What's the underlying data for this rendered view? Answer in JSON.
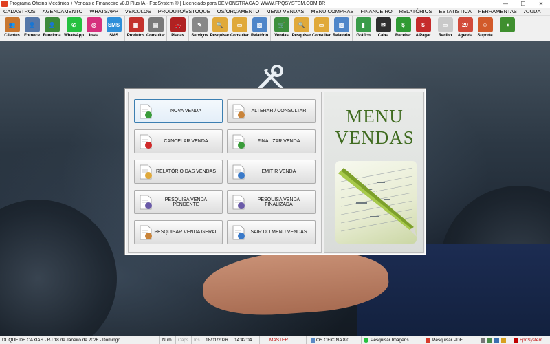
{
  "window": {
    "title": "Programa Oficina Mecânica + Vendas e Financeiro v8.0 Plus IA - FpqSystem ® | Licenciado para  DEMONSTRACAO WWW.FPQSYSTEM.COM.BR",
    "minimize": "—",
    "maximize": "☐",
    "close": "✕"
  },
  "menubar": [
    "CADASTROS",
    "AGENDAMENTO",
    "WHATSAPP",
    "VEICULOS",
    "PRODUTO/ESTOQUE",
    "OS/ORÇAMENTO",
    "MENU VENDAS",
    "MENU COMPRAS",
    "FINANCEIRO",
    "RELATÓRIOS",
    "ESTATISTICA",
    "FERRAMENTAS",
    "AJUDA"
  ],
  "toolbar": {
    "groups": [
      [
        {
          "label": "Clientes",
          "icon": "clients-icon",
          "color": "#c8762f",
          "glyph": "👥"
        },
        {
          "label": "Fornece",
          "icon": "supplier-icon",
          "color": "#5577a8",
          "glyph": "👤"
        },
        {
          "label": "Funciona",
          "icon": "employee-icon",
          "color": "#3e8a3a",
          "glyph": "👤"
        }
      ],
      [
        {
          "label": "WhatsApp",
          "icon": "whatsapp-icon",
          "color": "#25c13f",
          "glyph": "✆"
        },
        {
          "label": "Insta",
          "icon": "instagram-icon",
          "color": "#d6307d",
          "glyph": "◎"
        },
        {
          "label": "SMS",
          "icon": "sms-icon",
          "color": "#2e8fd9",
          "glyph": "SMS"
        }
      ],
      [
        {
          "label": "Produtos",
          "icon": "products-icon",
          "color": "#c4322d",
          "glyph": "▦"
        },
        {
          "label": "Consultar",
          "icon": "consult-icon",
          "color": "#7a7a7a",
          "glyph": "▤"
        }
      ],
      [
        {
          "label": "Placas",
          "icon": "car-icon",
          "color": "#b02222",
          "glyph": "🚗"
        }
      ],
      [
        {
          "label": "Serviços",
          "icon": "services-icon",
          "color": "#888888",
          "glyph": "✎"
        },
        {
          "label": "Pesquisar",
          "icon": "search-folder-icon",
          "color": "#e0a93a",
          "glyph": "🔍"
        },
        {
          "label": "Consultar",
          "icon": "consult-folder-icon",
          "color": "#e0a93a",
          "glyph": "▭"
        },
        {
          "label": "Relatório",
          "icon": "report-icon",
          "color": "#4f86c9",
          "glyph": "▨"
        }
      ],
      [
        {
          "label": "Vendas",
          "icon": "cart-icon",
          "color": "#3d8f3d",
          "glyph": "🛒"
        },
        {
          "label": "Pesquisar",
          "icon": "search-folder-icon",
          "color": "#e0a93a",
          "glyph": "🔍"
        },
        {
          "label": "Consultar",
          "icon": "consult-folder-icon",
          "color": "#e0a93a",
          "glyph": "▭"
        },
        {
          "label": "Relatório",
          "icon": "report-icon",
          "color": "#4f86c9",
          "glyph": "▨"
        }
      ],
      [
        {
          "label": "Gráfico",
          "icon": "chart-icon",
          "color": "#3a9c4a",
          "glyph": "▮"
        },
        {
          "label": "Caixa",
          "icon": "cash-icon",
          "color": "#2f2f2f",
          "glyph": "✉"
        },
        {
          "label": "Receber",
          "icon": "receive-icon",
          "color": "#2f9a33",
          "glyph": "$"
        },
        {
          "label": "A Pagar",
          "icon": "pay-icon",
          "color": "#c52b2b",
          "glyph": "$"
        }
      ],
      [
        {
          "label": "Recibo",
          "icon": "receipt-icon",
          "color": "#c9c9c9",
          "glyph": "▭"
        },
        {
          "label": "Agenda",
          "icon": "calendar-icon",
          "color": "#d24a3a",
          "glyph": "29"
        },
        {
          "label": "Suporte",
          "icon": "support-icon",
          "color": "#d25a2a",
          "glyph": "☺"
        }
      ],
      [
        {
          "label": "",
          "icon": "exit-icon",
          "color": "#3f8f2f",
          "glyph": "⇥"
        }
      ]
    ]
  },
  "panel": {
    "title_line1": "MENU",
    "title_line2": "VENDAS",
    "buttons": [
      {
        "label": "NOVA VENDA",
        "icon": "new-sale-icon"
      },
      {
        "label": "ALTERAR / CONSULTAR",
        "icon": "edit-icon"
      },
      {
        "label": "CANCELAR VENDA",
        "icon": "cancel-sale-icon"
      },
      {
        "label": "FINALIZAR VENDA",
        "icon": "finalize-sale-icon"
      },
      {
        "label": "RELATÓRIO DAS VENDAS",
        "icon": "sales-report-icon"
      },
      {
        "label": "EMITIR VENDA",
        "icon": "issue-sale-icon"
      },
      {
        "label": "PESQUISA VENDA PENDENTE",
        "icon": "pending-search-icon"
      },
      {
        "label": "PESQUISA VENDA FINALIZADA",
        "icon": "finalized-search-icon"
      },
      {
        "label": "PESQUISAR VENDA GERAL",
        "icon": "general-search-icon"
      },
      {
        "label": "SAIR DO MENU VENDAS",
        "icon": "exit-menu-icon"
      }
    ]
  },
  "statusbar": {
    "location": "DUQUE DE CAXIAS - RJ 18 de Janeiro de 2026 - Domingo",
    "num": "Num",
    "caps": "Caps",
    "ins": "Ins",
    "date": "18/01/2026",
    "time": "14:42:04",
    "user": "MASTER",
    "version": "OS OFICINA 8.0",
    "search_images": "Pesquisar Imagens",
    "search_pdf": "Pesquisar PDF",
    "brand": "FpqSystem"
  }
}
